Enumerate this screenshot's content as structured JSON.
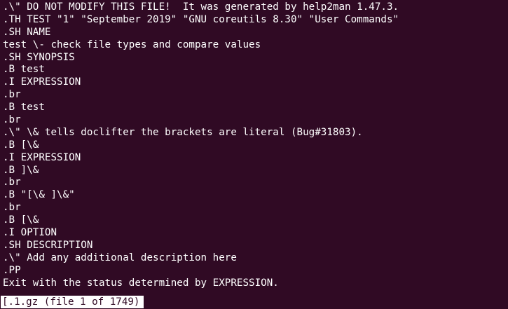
{
  "terminal": {
    "lines": [
      ".\\\" DO NOT MODIFY THIS FILE!  It was generated by help2man 1.47.3.",
      ".TH TEST \"1\" \"September 2019\" \"GNU coreutils 8.30\" \"User Commands\"",
      ".SH NAME",
      "test \\- check file types and compare values",
      ".SH SYNOPSIS",
      ".B test",
      ".I EXPRESSION",
      ".br",
      ".B test",
      ".br",
      ".\\\" \\& tells doclifter the brackets are literal (Bug#31803).",
      ".B [\\&",
      ".I EXPRESSION",
      ".B ]\\&",
      ".br",
      ".B \"[\\& ]\\&\"",
      ".br",
      ".B [\\&",
      ".I OPTION",
      ".SH DESCRIPTION",
      ".\\\" Add any additional description here",
      ".PP",
      "Exit with the status determined by EXPRESSION."
    ],
    "status_line": "[.1.gz (file 1 of 1749)"
  },
  "colors": {
    "background": "#300a24",
    "text": "#ffffff",
    "status_background": "#ffffff",
    "status_text": "#300a24"
  }
}
